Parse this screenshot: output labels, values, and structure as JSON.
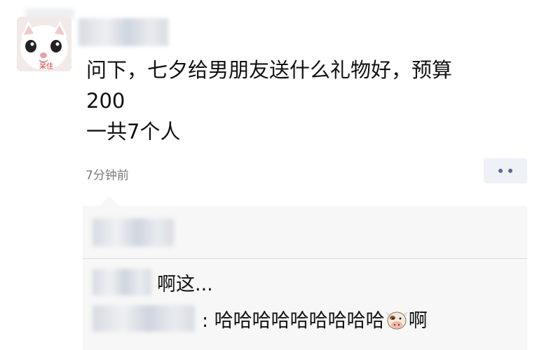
{
  "post": {
    "lines": [
      "问下，七夕给男朋友送什么礼物好，预算",
      "200",
      "一共7个人"
    ],
    "time": "7分钟前",
    "avatar_badge": "呆住"
  },
  "comments": [
    {
      "text": "啊这..."
    },
    {
      "text": ": 哈哈哈哈哈哈哈哈哈",
      "emoji": "cow-face-icon",
      "suffix": "啊"
    }
  ]
}
